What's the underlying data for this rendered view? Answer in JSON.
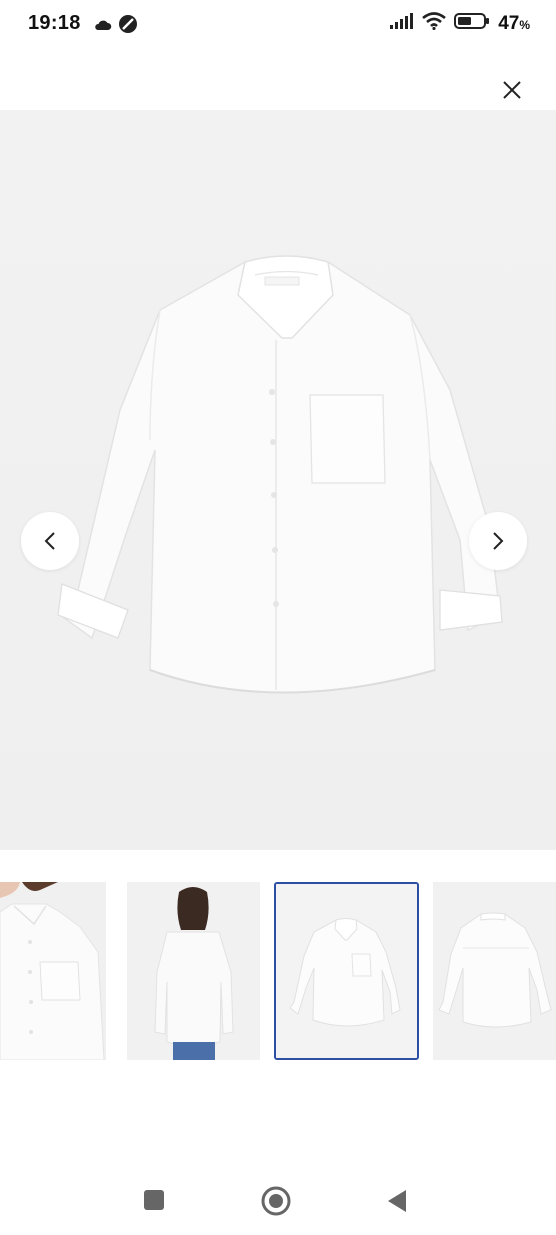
{
  "status_bar": {
    "time": "19:18",
    "battery_percent": "47",
    "battery_unit": "%",
    "icons": [
      "cloud-icon",
      "dnd-icon",
      "signal-icon",
      "wifi-icon",
      "battery-icon"
    ]
  },
  "viewer": {
    "close_icon": "close-icon",
    "prev_icon": "chevron-left-icon",
    "next_icon": "chevron-right-icon",
    "selected_thumbnail_index": 2,
    "thumbnail_count": 4,
    "selected_border_color": "#2c4fa3"
  },
  "nav_bar": {
    "icons": [
      "recents-square-icon",
      "home-circle-icon",
      "back-triangle-icon"
    ]
  }
}
